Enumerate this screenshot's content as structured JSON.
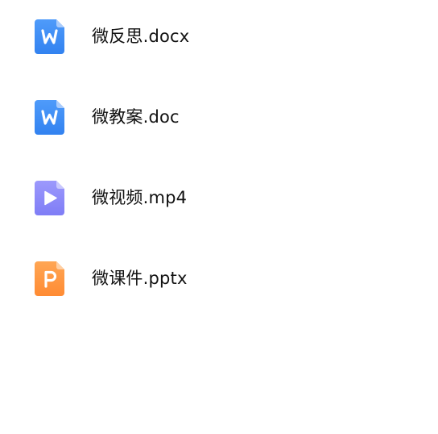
{
  "files": [
    {
      "name": "微反思.docx",
      "type": "word",
      "icon": "word-doc-icon",
      "color": "#3D8BF5"
    },
    {
      "name": "微教案.doc",
      "type": "word",
      "icon": "word-doc-icon",
      "color": "#3D8BF5"
    },
    {
      "name": "微视频.mp4",
      "type": "video",
      "icon": "video-file-icon",
      "color": "#8D8BFA"
    },
    {
      "name": "微课件.pptx",
      "type": "powerpoint",
      "icon": "powerpoint-file-icon",
      "color": "#FF9742"
    }
  ]
}
